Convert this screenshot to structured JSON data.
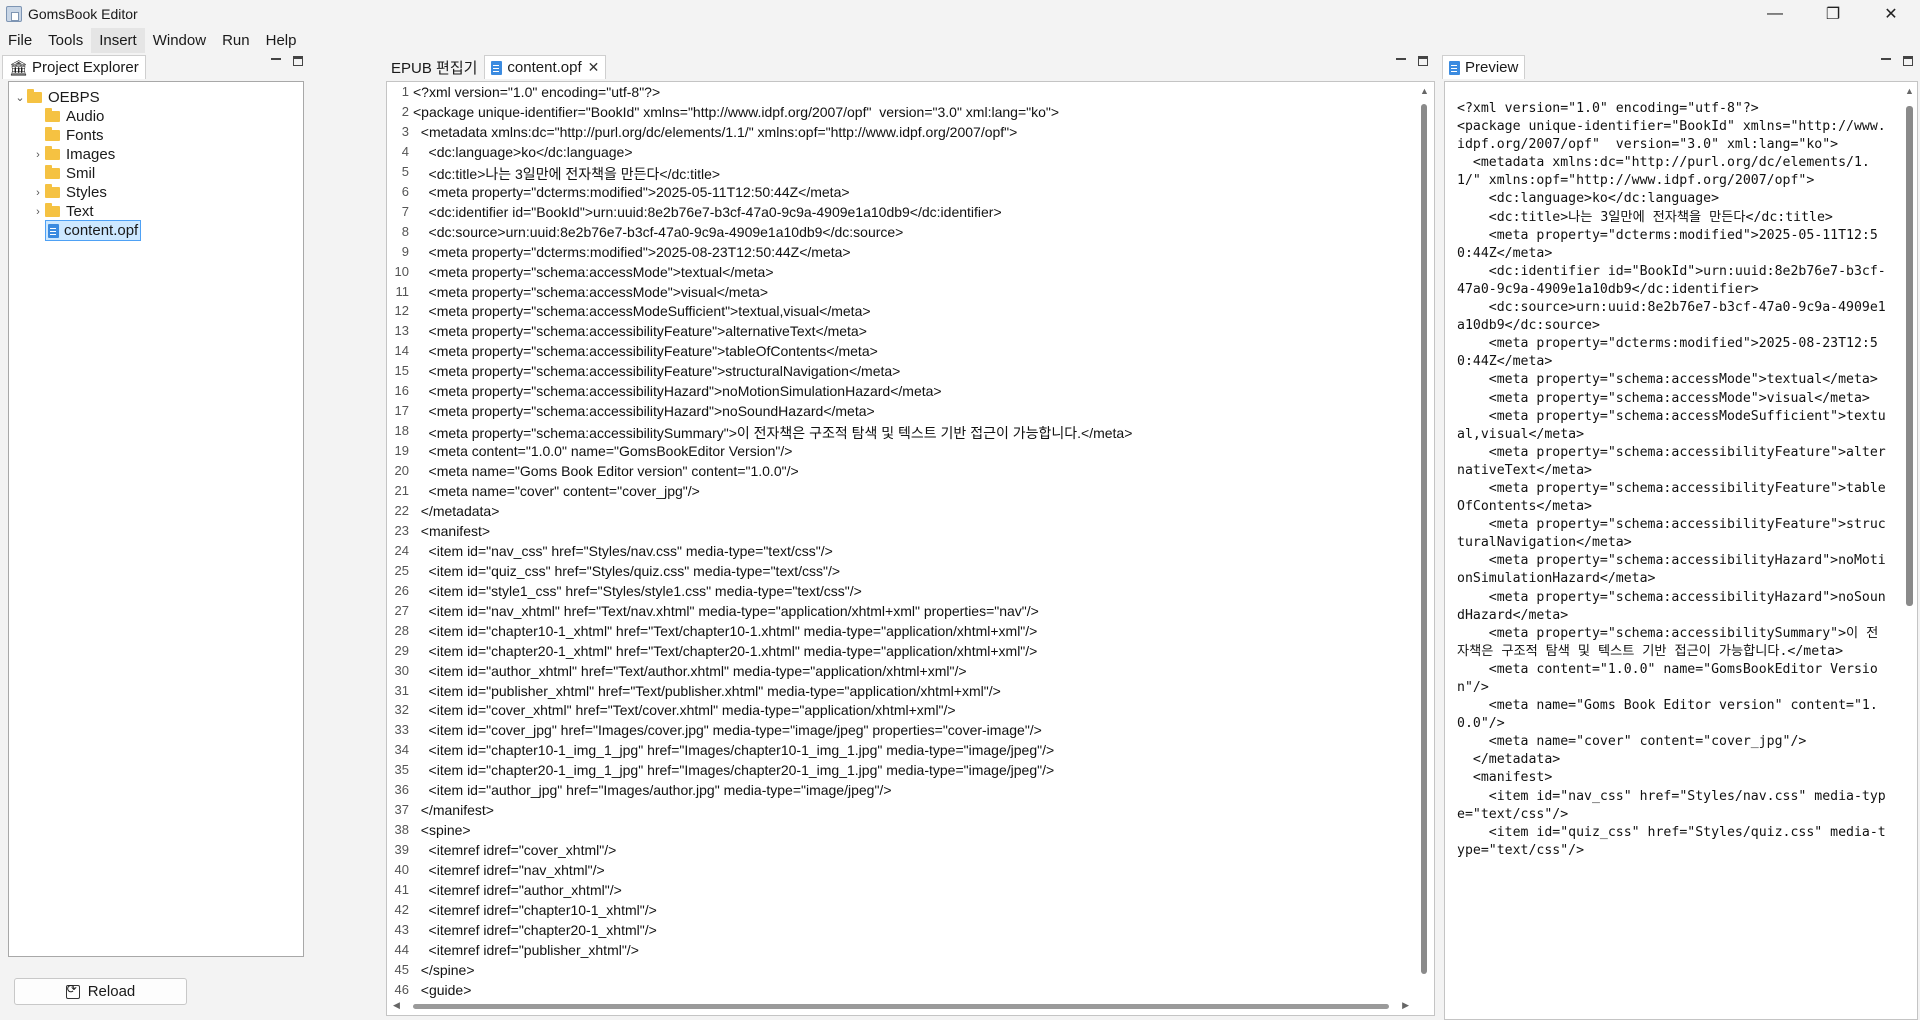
{
  "app": {
    "title": "GomsBook Editor",
    "window_controls": {
      "minimize": "—",
      "maximize": "❐",
      "close": "✕"
    }
  },
  "menu": [
    "File",
    "Tools",
    "Insert",
    "Window",
    "Run",
    "Help"
  ],
  "project_explorer": {
    "tab_label": "Project Explorer",
    "tree": [
      {
        "label": "OEBPS",
        "type": "folder",
        "expanded": true,
        "depth": 0
      },
      {
        "label": "Audio",
        "type": "folder",
        "expanded": false,
        "depth": 1,
        "has_children": false
      },
      {
        "label": "Fonts",
        "type": "folder",
        "expanded": false,
        "depth": 1,
        "has_children": false
      },
      {
        "label": "Images",
        "type": "folder",
        "expanded": false,
        "depth": 1,
        "has_children": true
      },
      {
        "label": "Smil",
        "type": "folder",
        "expanded": false,
        "depth": 1,
        "has_children": false
      },
      {
        "label": "Styles",
        "type": "folder",
        "expanded": false,
        "depth": 1,
        "has_children": true
      },
      {
        "label": "Text",
        "type": "folder",
        "expanded": false,
        "depth": 1,
        "has_children": true
      },
      {
        "label": "content.opf",
        "type": "file",
        "depth": 1,
        "selected": true
      }
    ],
    "reload_label": "Reload"
  },
  "editor": {
    "tabs": [
      {
        "label": "EPUB 편집기",
        "active": false
      },
      {
        "label": "content.opf",
        "active": true,
        "closable": true
      }
    ],
    "lines": [
      "<?xml version=\"1.0\" encoding=\"utf-8\"?>",
      "<package unique-identifier=\"BookId\" xmlns=\"http://www.idpf.org/2007/opf\"  version=\"3.0\" xml:lang=\"ko\">",
      "  <metadata xmlns:dc=\"http://purl.org/dc/elements/1.1/\" xmlns:opf=\"http://www.idpf.org/2007/opf\">",
      "    <dc:language>ko</dc:language>",
      "    <dc:title>나는 3일만에 전자책을 만든다</dc:title>",
      "    <meta property=\"dcterms:modified\">2025-05-11T12:50:44Z</meta>",
      "    <dc:identifier id=\"BookId\">urn:uuid:8e2b76e7-b3cf-47a0-9c9a-4909e1a10db9</dc:identifier>",
      "    <dc:source>urn:uuid:8e2b76e7-b3cf-47a0-9c9a-4909e1a10db9</dc:source>",
      "    <meta property=\"dcterms:modified\">2025-08-23T12:50:44Z</meta>",
      "    <meta property=\"schema:accessMode\">textual</meta>",
      "    <meta property=\"schema:accessMode\">visual</meta>",
      "    <meta property=\"schema:accessModeSufficient\">textual,visual</meta>",
      "    <meta property=\"schema:accessibilityFeature\">alternativeText</meta>",
      "    <meta property=\"schema:accessibilityFeature\">tableOfContents</meta>",
      "    <meta property=\"schema:accessibilityFeature\">structuralNavigation</meta>",
      "    <meta property=\"schema:accessibilityHazard\">noMotionSimulationHazard</meta>",
      "    <meta property=\"schema:accessibilityHazard\">noSoundHazard</meta>",
      "    <meta property=\"schema:accessibilitySummary\">이 전자책은 구조적 탐색 및 텍스트 기반 접근이 가능합니다.</meta>",
      "    <meta content=\"1.0.0\" name=\"GomsBookEditor Version\"/>",
      "    <meta name=\"Goms Book Editor version\" content=\"1.0.0\"/>",
      "    <meta name=\"cover\" content=\"cover_jpg\"/>",
      "  </metadata>",
      "  <manifest>",
      "    <item id=\"nav_css\" href=\"Styles/nav.css\" media-type=\"text/css\"/>",
      "    <item id=\"quiz_css\" href=\"Styles/quiz.css\" media-type=\"text/css\"/>",
      "    <item id=\"style1_css\" href=\"Styles/style1.css\" media-type=\"text/css\"/>",
      "    <item id=\"nav_xhtml\" href=\"Text/nav.xhtml\" media-type=\"application/xhtml+xml\" properties=\"nav\"/>",
      "    <item id=\"chapter10-1_xhtml\" href=\"Text/chapter10-1.xhtml\" media-type=\"application/xhtml+xml\"/>",
      "    <item id=\"chapter20-1_xhtml\" href=\"Text/chapter20-1.xhtml\" media-type=\"application/xhtml+xml\"/>",
      "    <item id=\"author_xhtml\" href=\"Text/author.xhtml\" media-type=\"application/xhtml+xml\"/>",
      "    <item id=\"publisher_xhtml\" href=\"Text/publisher.xhtml\" media-type=\"application/xhtml+xml\"/>",
      "    <item id=\"cover_xhtml\" href=\"Text/cover.xhtml\" media-type=\"application/xhtml+xml\"/>",
      "    <item id=\"cover_jpg\" href=\"Images/cover.jpg\" media-type=\"image/jpeg\" properties=\"cover-image\"/>",
      "    <item id=\"chapter10-1_img_1_jpg\" href=\"Images/chapter10-1_img_1.jpg\" media-type=\"image/jpeg\"/>",
      "    <item id=\"chapter20-1_img_1_jpg\" href=\"Images/chapter20-1_img_1.jpg\" media-type=\"image/jpeg\"/>",
      "    <item id=\"author_jpg\" href=\"Images/author.jpg\" media-type=\"image/jpeg\"/>",
      "  </manifest>",
      "  <spine>",
      "    <itemref idref=\"cover_xhtml\"/>",
      "    <itemref idref=\"nav_xhtml\"/>",
      "    <itemref idref=\"author_xhtml\"/>",
      "    <itemref idref=\"chapter10-1_xhtml\"/>",
      "    <itemref idref=\"chapter20-1_xhtml\"/>",
      "    <itemref idref=\"publisher_xhtml\"/>",
      "  </spine>",
      "  <guide>"
    ]
  },
  "preview": {
    "tab_label": "Preview",
    "content": "<?xml version=\"1.0\" encoding=\"utf-8\"?>\n<package unique-identifier=\"BookId\" xmlns=\"http://www.idpf.org/2007/opf\"  version=\"3.0\" xml:lang=\"ko\">\n  <metadata xmlns:dc=\"http://purl.org/dc/elements/1.1/\" xmlns:opf=\"http://www.idpf.org/2007/opf\">\n    <dc:language>ko</dc:language>\n    <dc:title>나는 3일만에 전자책을 만든다</dc:title>\n    <meta property=\"dcterms:modified\">2025-05-11T12:50:44Z</meta>\n    <dc:identifier id=\"BookId\">urn:uuid:8e2b76e7-b3cf-47a0-9c9a-4909e1a10db9</dc:identifier>\n    <dc:source>urn:uuid:8e2b76e7-b3cf-47a0-9c9a-4909e1a10db9</dc:source>\n    <meta property=\"dcterms:modified\">2025-08-23T12:50:44Z</meta>\n    <meta property=\"schema:accessMode\">textual</meta>\n    <meta property=\"schema:accessMode\">visual</meta>\n    <meta property=\"schema:accessModeSufficient\">textual,visual</meta>\n    <meta property=\"schema:accessibilityFeature\">alternativeText</meta>\n    <meta property=\"schema:accessibilityFeature\">tableOfContents</meta>\n    <meta property=\"schema:accessibilityFeature\">structuralNavigation</meta>\n    <meta property=\"schema:accessibilityHazard\">noMotionSimulationHazard</meta>\n    <meta property=\"schema:accessibilityHazard\">noSoundHazard</meta>\n    <meta property=\"schema:accessibilitySummary\">이 전자책은 구조적 탐색 및 텍스트 기반 접근이 가능합니다.</meta>\n    <meta content=\"1.0.0\" name=\"GomsBookEditor Version\"/>\n    <meta name=\"Goms Book Editor version\" content=\"1.0.0\"/>\n    <meta name=\"cover\" content=\"cover_jpg\"/>\n  </metadata>\n  <manifest>\n    <item id=\"nav_css\" href=\"Styles/nav.css\" media-type=\"text/css\"/>\n    <item id=\"quiz_css\" href=\"Styles/quiz.css\" media-type=\"text/css\"/>"
  },
  "colors": {
    "accent": "#4ea1f5",
    "selection_bg": "#cde8ff",
    "folder": "#f5c242",
    "file": "#3b8be0"
  },
  "icons": {
    "app": "book-icon",
    "explorer": "bank-icon",
    "folder": "folder-icon",
    "file": "document-icon",
    "reload": "refresh-icon"
  }
}
